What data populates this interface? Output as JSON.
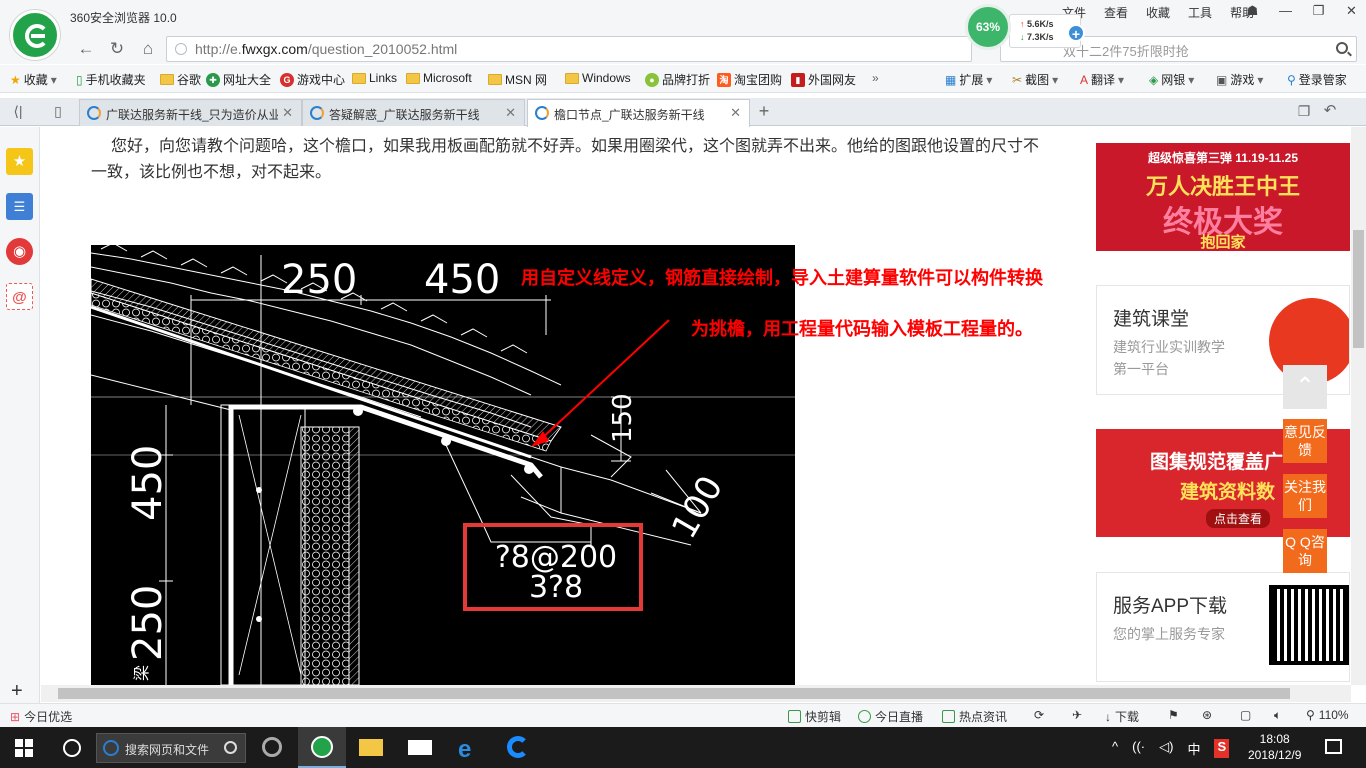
{
  "browser": {
    "title": "360安全浏览器 10.0",
    "menu": [
      "文件",
      "查看",
      "收藏",
      "工具",
      "帮助"
    ],
    "speed": {
      "percent": "63%",
      "up": "5.6K/s",
      "down": "7.3K/s"
    },
    "url": {
      "prefix": "http://e.",
      "domain": "fwxgx.com",
      "path": "/question_2010052.html"
    },
    "search_placeholder": "双十二2件75折限时抢",
    "bookmarks": [
      "收藏",
      "手机收藏夹",
      "谷歌",
      "网址大全",
      "游戏中心",
      "Links",
      "Microsoft",
      "MSN 网",
      "Windows",
      "品牌打折",
      "淘宝团购",
      "外国网友"
    ],
    "more": "»",
    "tools": [
      "扩展",
      "截图",
      "翻译",
      "网银",
      "游戏",
      "登录管家"
    ],
    "tabs": [
      {
        "title": "广联达服务新干线_只为造价从业"
      },
      {
        "title": "答疑解惑_广联达服务新干线"
      },
      {
        "title": "檐口节点_广联达服务新干线"
      }
    ],
    "new_tab": "+"
  },
  "question": {
    "text": "您好，向您请教个问题哈，这个檐口，如果我用板画配筋就不好弄。如果用圈梁代，这个图就弄不出来。他给的图跟他设置的尺寸不一致，该比例也不想，对不起来。"
  },
  "cad": {
    "dims": {
      "d250_top": "250",
      "d450_top": "450",
      "d150": "150",
      "d100": "100",
      "d450_left": "450",
      "d250_left": "250"
    },
    "rebar_1": "?8@200",
    "rebar_2": "3?8",
    "side_label": "梁"
  },
  "annotation": {
    "line1": "用自定义线定义，钢筋直接绘制，导入土建算量软件可以构件转换",
    "line2": "为挑檐，用工程量代码输入模板工程量的。"
  },
  "ads": {
    "ad1": {
      "banner": "超级惊喜第三弹  11.19-11.25",
      "main": "万人决胜王中王",
      "big": "终极大奖",
      "sub": "抱回家"
    },
    "ad2": {
      "title": "建筑课堂",
      "sub": "建筑行业实训教学第一平台"
    },
    "ad3": {
      "main": "图集规范覆盖广",
      "second": "建筑资料数",
      "cta": "点击查看"
    },
    "ad4": {
      "title": "服务APP下载",
      "sub": "您的掌上服务专家"
    }
  },
  "float_buttons": [
    "意见反馈",
    "关注我们",
    "Q Q咨询"
  ],
  "status": {
    "left": "今日优选",
    "items": [
      "快剪辑",
      "今日直播",
      "热点资讯",
      "下载"
    ],
    "zoom": "110%"
  },
  "taskbar": {
    "search_placeholder": "搜索网页和文件",
    "ime": "中",
    "time": "18:08",
    "date": "2018/12/9"
  },
  "colors": {
    "brand_green": "#22a34a",
    "accent_red": "#ff0000",
    "float_orange": "#f26b1d"
  }
}
